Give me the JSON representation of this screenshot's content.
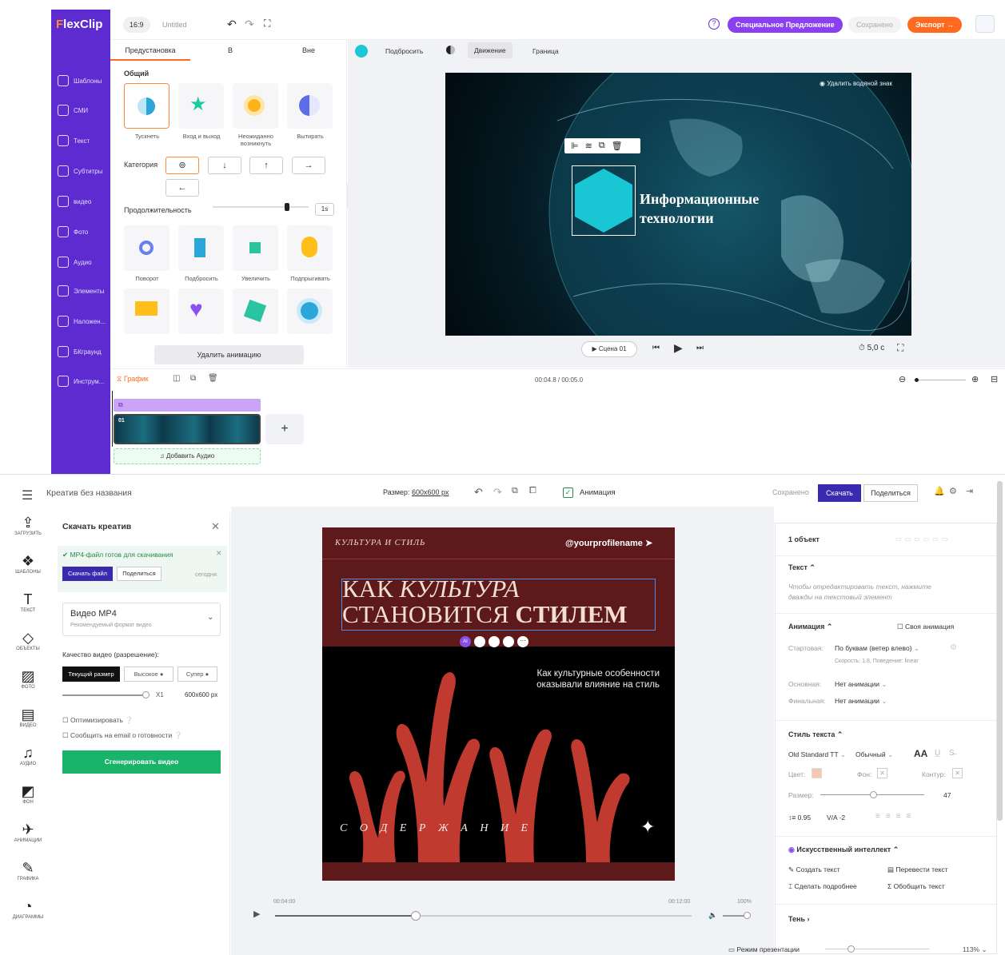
{
  "flexclip": {
    "logo_pre": "F",
    "logo_rest": "lexClip",
    "ratio": "16:9",
    "doc_title": "Untitled",
    "special_offer": "Специальное Предложение",
    "saved": "Сохранено",
    "export": "Экспорт",
    "sidebar": [
      {
        "label": "Шаблоны"
      },
      {
        "label": "СМИ"
      },
      {
        "label": "Текст"
      },
      {
        "label": "Субтитры"
      },
      {
        "label": "видео"
      },
      {
        "label": "Фото"
      },
      {
        "label": "Аудио"
      },
      {
        "label": "Элементы"
      },
      {
        "label": "Наложен..."
      },
      {
        "label": "БКграунд"
      },
      {
        "label": "Инструм..."
      }
    ],
    "tabs": [
      "Предустановка",
      "В",
      "Вне"
    ],
    "section_general": "Общий",
    "effects_row1": [
      "Тускнеть",
      "Вход и выход",
      "Неожиданно возникнуть",
      "Вытирать"
    ],
    "category_label": "Категория",
    "duration_label": "Продолжительность",
    "duration_value": "1s",
    "effects_row2": [
      "Поворот",
      "Подбросить",
      "Увеличить",
      "Подпрыгивать"
    ],
    "remove_animation": "Удалить анимацию",
    "toolbar": [
      "Подбросить",
      "Движение",
      "Граница"
    ],
    "watermark": "Удалить водяной знак",
    "scene_title_1": "Информационные",
    "scene_title_2": "технологии",
    "scene_btn": "Сцена 01",
    "duration_total": "5,0 с",
    "timeline_tab": "График",
    "time_display": "00:04.8 / 00:05.0",
    "clip_number": "01",
    "add_audio": "Добавить Аудио",
    "plus": "+"
  },
  "editor": {
    "title": "Креатив без названия",
    "size_label": "Размер:",
    "size_value": "600x600 px",
    "animation_label": "Анимация",
    "saved": "Сохранено",
    "download": "Скачать",
    "share": "Поделиться",
    "left_tools": [
      {
        "label": "ЗАГРУЗИТЬ",
        "icon": "upload-icon",
        "glyph": "⇪"
      },
      {
        "label": "ШАБЛОНЫ",
        "icon": "templates-icon",
        "glyph": "❖"
      },
      {
        "label": "ТЕКСТ",
        "icon": "text-icon",
        "glyph": "T"
      },
      {
        "label": "ОБЪЕКТЫ",
        "icon": "objects-icon",
        "glyph": "◇"
      },
      {
        "label": "ФОТО",
        "icon": "photo-icon",
        "glyph": "▨"
      },
      {
        "label": "ВИДЕО",
        "icon": "video-icon",
        "glyph": "▤"
      },
      {
        "label": "АУДИО",
        "icon": "audio-icon",
        "glyph": "♫"
      },
      {
        "label": "ФОН",
        "icon": "background-icon",
        "glyph": "◩"
      },
      {
        "label": "АНИМАЦИИ",
        "icon": "animation-icon",
        "glyph": "✈"
      },
      {
        "label": "ГРАФИКА",
        "icon": "graphics-icon",
        "glyph": "✎"
      },
      {
        "label": "ДИАГРАММЫ",
        "icon": "charts-icon",
        "glyph": "◔"
      }
    ],
    "download_panel": {
      "title": "Скачать креатив",
      "ready": "MP4-файл готов для скачивания",
      "download_file": "Скачать файл",
      "share": "Поделиться",
      "today": "сегодня",
      "format": "Видео MP4",
      "format_sub": "Рекомендуемый формат видео",
      "quality_label": "Качество видео (разрешение):",
      "quality_current": "Текущий размер",
      "quality_high": "Высокое",
      "quality_super": "Супер",
      "multiplier": "X1",
      "resolution": "600x600 px",
      "optimize": "Оптимизировать",
      "notify": "Сообщить на email о готовности",
      "generate": "Сгенерировать видео"
    },
    "canvas": {
      "header_left": "КУЛЬТУРА И СТИЛЬ",
      "profile": "@yourprofilename",
      "headline_1a": "КАК ",
      "headline_1b": "КУЛЬТУРА",
      "headline_2a": "СТАНОВИТСЯ ",
      "headline_2b": "СТИЛЕМ",
      "sub": "Как культурные особенности оказывали влияние на стиль",
      "contents": "С О Д Е Р Ж А Н И Е",
      "ai_badge": "AI"
    },
    "player": {
      "t1": "00:04:00",
      "t2": "00:12:00",
      "volume": "100%"
    },
    "right": {
      "objects": "1 объект",
      "text_section": "Текст",
      "text_hint": "Чтобы отредактировать текст, нажмите дважды на текстовый элемент",
      "anim_section": "Анимация",
      "own_anim": "Своя анимация",
      "start_label": "Стартовая:",
      "start_value": "По буквам (ветер влево)",
      "speed_info": "Скорость: 1.8, Поведение: linear",
      "main_label": "Основная:",
      "main_value": "Нет анимации",
      "final_label": "Финальная:",
      "final_value": "Нет анимации",
      "style_section": "Стиль текста",
      "font": "Old Standard TT",
      "weight": "Обычный",
      "aa": "AA",
      "color_label": "Цвет:",
      "bg_label": "Фон:",
      "outline_label": "Контур:",
      "size_label": "Размер:",
      "size_value": "47",
      "line_height": "0.95",
      "letter_spacing": "-2",
      "ai_section": "Искусственный интеллект",
      "create_text": "Создать текст",
      "translate_text": "Перевести текст",
      "detail": "Сделать подробнее",
      "summarize": "Обобщить текст",
      "shadow": "Тень",
      "presentation": "Режим презентации",
      "zoom": "113%"
    }
  }
}
